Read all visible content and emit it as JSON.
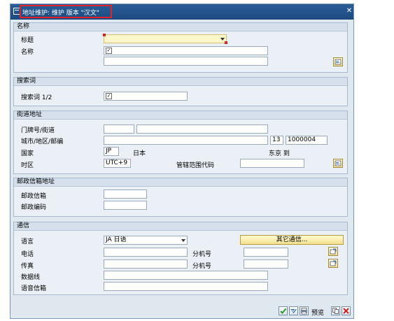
{
  "title": "地址维护: 维护 版本 \"汉文\"",
  "close_glyph": "✕",
  "groups": {
    "name": {
      "header": "名称",
      "title_label": "标题",
      "title_value": "",
      "name_label": "名称",
      "name_value": "",
      "name2_value": ""
    },
    "search": {
      "header": "搜索词",
      "term_label": "搜索词 1/2",
      "term_value": ""
    },
    "street": {
      "header": "街道地址",
      "house_street_label": "门牌号/街道",
      "house_value": "",
      "street_value": "",
      "city_label": "城市/地区/邮编",
      "city_value": "",
      "region_value": "13",
      "postal_value": "1000004",
      "country_label": "国家",
      "country_code": "JP",
      "country_name": "日本",
      "region_name": "东京 到",
      "timezone_label": "时区",
      "timezone_value": "UTC+9",
      "jurisdiction_label": "管辖范围代码",
      "jurisdiction_value": ""
    },
    "pobox": {
      "header": "邮政信箱地址",
      "box_label": "邮政信箱",
      "box_value": "",
      "postal_label": "邮政编码",
      "postal_value": ""
    },
    "comm": {
      "header": "通信",
      "language_label": "语言",
      "language_value": "JA 日语",
      "other_button": "其它通信...",
      "phone_label": "电话",
      "phone_value": "",
      "ext_label": "分机号",
      "phone_ext_value": "",
      "fax_label": "传真",
      "fax_value": "",
      "fax_ext_label": "分机号",
      "fax_ext_value": "",
      "data_line_label": "数据线",
      "data_line_value": "",
      "voicemail_label": "语音信箱",
      "voicemail_value": ""
    }
  },
  "footer": {
    "preview_label": "预览"
  },
  "colors": {
    "titlebar": "#1c4a80",
    "highlight": "#e0222a",
    "panel": "#dfe7ef"
  }
}
